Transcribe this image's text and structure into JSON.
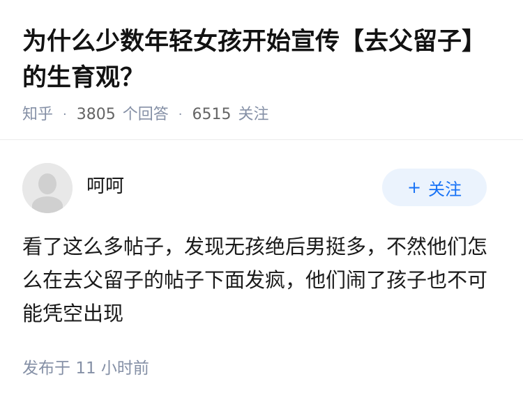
{
  "question": {
    "title": "为什么少数年轻女孩开始宣传【去父留子】的生育观？",
    "source": "知乎",
    "answers_count": "3805",
    "answers_label": "个回答",
    "followers_count": "6515",
    "followers_label": "关注"
  },
  "answer": {
    "author_name": "呵呵",
    "follow_button_label": "关注",
    "follow_button_icon": "plus-icon",
    "content": "看了这么多帖子，发现无孩绝后男挺多，不然他们怎么在去父留子的帖子下面发疯，他们闹了孩子也不可能凭空出现",
    "published_label": "发布于",
    "published_value": "11",
    "published_unit": "小时前"
  },
  "colors": {
    "accent": "#1772f6",
    "follow_bg": "#ebf3fd",
    "meta": "#8590a6",
    "avatar_bg": "#e8e8e8"
  }
}
